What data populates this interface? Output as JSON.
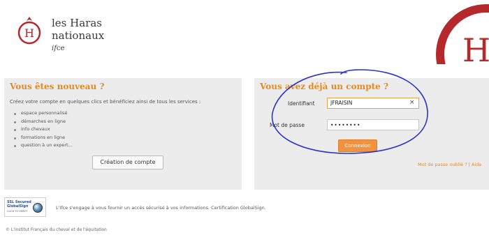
{
  "header": {
    "logo": {
      "emblem_letter": "H",
      "line1": "les Haras",
      "line2": "nationaux",
      "line3_prefix": "if",
      "line3_suffix": "ce"
    },
    "big_logo_letter": "H"
  },
  "new_user": {
    "title": "Vous êtes nouveau ?",
    "intro": "Créez votre compte en quelques clics et bénéficiez ainsi de tous les services :",
    "services": [
      "espace personnalisé",
      "démarches en ligne",
      "info chevaux",
      "formations en ligne",
      "question à un expert..."
    ],
    "create_button": "Création de compte"
  },
  "login": {
    "title": "Vous avez déjà un compte ?",
    "identifier_label": "Identifiant",
    "identifier_value": "JFRAISIN",
    "clear_icon": "×",
    "password_label": "Mot de passe",
    "password_mask": "••••••••",
    "submit_button": "Connexion",
    "forgot_link": "Mot de passe oublié ?",
    "separator": "|",
    "help_link": "Aide"
  },
  "security": {
    "badge_title": "SSL Secured",
    "badge_brand": "GlobalSign",
    "badge_sub": "CLICK TO VERIFY",
    "note": "L'Ifce s'engage à vous fournir un accès sécurisé à vos informations. Certification GlobalSign."
  },
  "footer": {
    "copyright": "© L'institut Français du cheval et de l'équitation"
  },
  "colors": {
    "accent": "#e8891e",
    "button": "#f09340",
    "panel": "#ececec",
    "brand_red": "#b5282c",
    "annotation": "#2a34c8"
  }
}
